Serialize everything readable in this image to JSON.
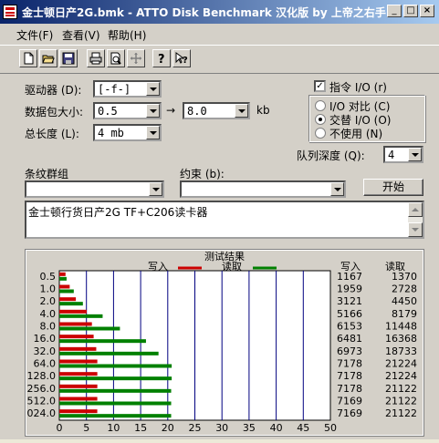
{
  "window": {
    "title": "金士顿日产2G.bmk - ATTO Disk Benchmark 汉化版 by 上帝之右手",
    "minimize": "_",
    "maximize": "□",
    "close": "×"
  },
  "menu": {
    "file": "文件(F)",
    "view": "查看(V)",
    "help": "帮助(H)"
  },
  "toolbar": {
    "icons": [
      "new-file-icon",
      "open-folder-icon",
      "save-icon",
      "print-icon",
      "print-preview-icon",
      "move-icon",
      "help-icon",
      "context-help-icon"
    ]
  },
  "form": {
    "drive_label": "驱动器 (D):",
    "drive_value": "[-f-]",
    "transfer_label": "数据包大小:",
    "transfer_from": "0.5",
    "transfer_arrow": "→",
    "transfer_to": "8.0",
    "transfer_unit": "kb",
    "length_label": "总长度 (L):",
    "length_value": "4 mb",
    "direct_io_label": "指令 I/O (r)",
    "direct_io_checked": "✓",
    "io_compare_label": "I/O 对比 (C)",
    "overlapped_label": "交替 I/O (O)",
    "neither_label": "不使用 (N)",
    "queue_label": "队列深度 (Q):",
    "queue_value": "4",
    "pattern_label": "条纹群组",
    "constraint_label": "约束 (b):",
    "start_button": "开始",
    "description": "金士顿行货日产2G TF+C206读卡器"
  },
  "results": {
    "title": "测试结果",
    "write_label": "写入",
    "read_label": "读取",
    "write_col": "写入",
    "read_col": "读取",
    "write_color": "#cc0000",
    "read_color": "#008000"
  },
  "chart_data": {
    "type": "bar",
    "orientation": "horizontal",
    "categories": [
      "0.5",
      "1.0",
      "2.0",
      "4.0",
      "8.0",
      "16.0",
      "32.0",
      "64.0",
      "128.0",
      "256.0",
      "512.0",
      "024.0"
    ],
    "series": [
      {
        "name": "写入",
        "values": [
          1167,
          1959,
          3121,
          5166,
          6153,
          6481,
          6973,
          7178,
          7178,
          7178,
          7169,
          7169
        ]
      },
      {
        "name": "读取",
        "values": [
          1370,
          2728,
          4450,
          8179,
          11448,
          16368,
          18733,
          21224,
          21224,
          21122,
          21122,
          21122
        ]
      }
    ],
    "write_text": [
      "1167",
      "1959",
      "3121",
      "5166",
      "6153",
      "6481",
      "6973",
      "7178",
      "7178",
      "7178",
      "7169",
      "7169"
    ],
    "read_text": [
      "1370",
      "2728",
      "4450",
      "8179",
      "11448",
      "16368",
      "18733",
      "21224",
      "21224",
      "21122",
      "21122",
      "21122"
    ],
    "xticks": [
      "0",
      "5",
      "10",
      "15",
      "20",
      "25",
      "30",
      "35",
      "40",
      "45",
      "50"
    ],
    "xlim": [
      0,
      50
    ]
  }
}
